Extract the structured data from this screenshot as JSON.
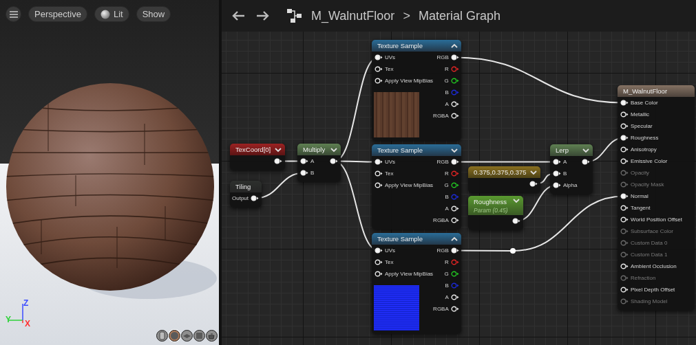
{
  "viewport": {
    "toolbar": [
      {
        "kind": "menu"
      },
      {
        "kind": "view",
        "label": "Perspective"
      },
      {
        "kind": "lighting",
        "label": "Lit"
      },
      {
        "kind": "view",
        "label": "Show"
      }
    ],
    "axis_labels": [
      {
        "label": "Z",
        "color": "#3b4cff"
      },
      {
        "label": "Y",
        "color": "#2fd23a"
      },
      {
        "label": "X",
        "color": "#ff3030"
      }
    ],
    "preview_shapes": [
      {
        "kind": "cylinder",
        "selected": false
      },
      {
        "kind": "sphere",
        "selected": true
      },
      {
        "kind": "plane",
        "selected": false
      },
      {
        "kind": "cube",
        "selected": false
      },
      {
        "kind": "custom",
        "selected": false
      }
    ]
  },
  "graph": {
    "breadcrumb": [
      "M_WalnutFloor",
      "Material Graph"
    ],
    "separator": ">",
    "nodes": [
      {
        "kind": "texcoord",
        "title": "TexCoord[0]",
        "expanded": false,
        "outputs": [
          {
            "connected": true
          }
        ]
      },
      {
        "kind": "function",
        "title": "Tiling",
        "outputs": [
          {
            "label": "Output",
            "connected": true
          }
        ]
      },
      {
        "kind": "math",
        "title": "Multiply",
        "expanded": false,
        "inputs": [
          {
            "label": "A",
            "connected": true
          },
          {
            "label": "B",
            "connected": true
          }
        ],
        "outputs": [
          {
            "connected": true
          }
        ]
      },
      {
        "kind": "texture_sample",
        "title": "Texture Sample",
        "expanded": true,
        "preview": {
          "kind": "wood"
        },
        "inputs": [
          {
            "label": "UVs",
            "connected": true
          },
          {
            "label": "Tex",
            "connected": false
          },
          {
            "label": "Apply View MipBias",
            "connected": false
          }
        ],
        "outputs": [
          {
            "label": "RGB",
            "connected": true
          },
          {
            "label": "R",
            "connected": false,
            "color": "#e02424"
          },
          {
            "label": "G",
            "connected": false,
            "color": "#22c422"
          },
          {
            "label": "B",
            "connected": false,
            "color": "#1c2ad8"
          },
          {
            "label": "A",
            "connected": false
          },
          {
            "label": "RGBA",
            "connected": false
          }
        ]
      },
      {
        "kind": "texture_sample",
        "title": "Texture Sample",
        "expanded": false,
        "inputs": [
          {
            "label": "UVs",
            "connected": true
          },
          {
            "label": "Tex",
            "connected": false
          },
          {
            "label": "Apply View MipBias",
            "connected": false
          }
        ],
        "outputs": [
          {
            "label": "RGB",
            "connected": true
          },
          {
            "label": "R",
            "connected": false,
            "color": "#e02424"
          },
          {
            "label": "G",
            "connected": false,
            "color": "#22c422"
          },
          {
            "label": "B",
            "connected": false,
            "color": "#1c2ad8"
          },
          {
            "label": "A",
            "connected": false
          },
          {
            "label": "RGBA",
            "connected": false
          }
        ]
      },
      {
        "kind": "texture_sample",
        "title": "Texture Sample",
        "expanded": true,
        "preview": {
          "kind": "normal"
        },
        "inputs": [
          {
            "label": "UVs",
            "connected": true
          },
          {
            "label": "Tex",
            "connected": false
          },
          {
            "label": "Apply View MipBias",
            "connected": false
          }
        ],
        "outputs": [
          {
            "label": "RGB",
            "connected": true
          },
          {
            "label": "R",
            "connected": false,
            "color": "#e02424"
          },
          {
            "label": "G",
            "connected": false,
            "color": "#22c422"
          },
          {
            "label": "B",
            "connected": false,
            "color": "#1c2ad8"
          },
          {
            "label": "A",
            "connected": false
          },
          {
            "label": "RGBA",
            "connected": false
          }
        ]
      },
      {
        "kind": "constant",
        "title": "0.375,0.375,0.375",
        "expanded": false,
        "outputs": [
          {
            "connected": true
          }
        ]
      },
      {
        "kind": "parameter",
        "title": "Roughness",
        "subtitle": "Param (0.45)",
        "expanded": false,
        "outputs": [
          {
            "connected": true
          }
        ]
      },
      {
        "kind": "math",
        "title": "Lerp",
        "expanded": false,
        "inputs": [
          {
            "label": "A",
            "connected": true
          },
          {
            "label": "B",
            "connected": true
          },
          {
            "label": "Alpha",
            "connected": true
          }
        ],
        "outputs": [
          {
            "connected": true
          }
        ]
      },
      {
        "kind": "result",
        "title": "M_WalnutFloor",
        "inputs": [
          {
            "label": "Base Color",
            "connected": true,
            "disabled": false
          },
          {
            "label": "Metallic",
            "connected": false,
            "disabled": false
          },
          {
            "label": "Specular",
            "connected": false,
            "disabled": false
          },
          {
            "label": "Roughness",
            "connected": true,
            "disabled": false
          },
          {
            "label": "Anisotropy",
            "connected": false,
            "disabled": false
          },
          {
            "label": "Emissive Color",
            "connected": false,
            "disabled": false
          },
          {
            "label": "Opacity",
            "connected": false,
            "disabled": true
          },
          {
            "label": "Opacity Mask",
            "connected": false,
            "disabled": true
          },
          {
            "label": "Normal",
            "connected": true,
            "disabled": false
          },
          {
            "label": "Tangent",
            "connected": false,
            "disabled": false
          },
          {
            "label": "World Position Offset",
            "connected": false,
            "disabled": false
          },
          {
            "label": "Subsurface Color",
            "connected": false,
            "disabled": true
          },
          {
            "label": "Custom Data 0",
            "connected": false,
            "disabled": true
          },
          {
            "label": "Custom Data 1",
            "connected": false,
            "disabled": true
          },
          {
            "label": "Ambient Occlusion",
            "connected": false,
            "disabled": false
          },
          {
            "label": "Refraction",
            "connected": false,
            "disabled": true
          },
          {
            "label": "Pixel Depth Offset",
            "connected": false,
            "disabled": false
          },
          {
            "label": "Shading Model",
            "connected": false,
            "disabled": true
          }
        ]
      }
    ]
  }
}
